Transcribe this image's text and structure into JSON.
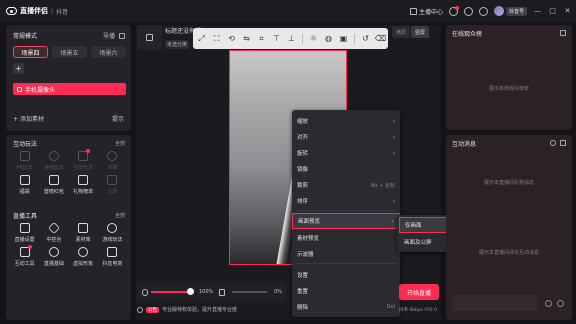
{
  "titlebar": {
    "app_name": "直播伴侣",
    "separator": "|",
    "platform": "抖音",
    "anchor_center": "主播中心",
    "user_name": "抖音号",
    "minimize": "—",
    "maximize": "□",
    "close": "✕"
  },
  "scenes": {
    "title": "常规模式",
    "guide": "导播",
    "tabs": [
      "场景四",
      "场景五",
      "场景六"
    ],
    "add": "+",
    "sources": [
      "手机摄像头"
    ],
    "add_material": "添加素材",
    "hint": "提示"
  },
  "interaction_tools": {
    "title": "互动玩法",
    "more": "全部",
    "items": [
      {
        "label": "PK玩法",
        "enabled": false
      },
      {
        "label": "连线玩法",
        "enabled": false
      },
      {
        "label": "互动玩法",
        "enabled": false
      },
      {
        "label": "点歌",
        "enabled": false
      },
      {
        "label": "福袋",
        "enabled": true
      },
      {
        "label": "登榜红包",
        "enabled": true
      },
      {
        "label": "礼物榜单",
        "enabled": true
      },
      {
        "label": "心愿",
        "enabled": false
      }
    ]
  },
  "live_tools": {
    "title": "直播工具",
    "more": "全部",
    "items": [
      {
        "label": "直播设置"
      },
      {
        "label": "中控台"
      },
      {
        "label": "素材库"
      },
      {
        "label": "游戏玩法"
      },
      {
        "label": "互动工具"
      },
      {
        "label": "直播基础"
      },
      {
        "label": "虚拟形象"
      },
      {
        "label": "抖音电商"
      }
    ]
  },
  "center": {
    "live_title": "标题还没有想好",
    "category": "未选分类",
    "top_tabs": [
      "横屏",
      "竖屏"
    ],
    "toolbar_icons": [
      "fit-icon",
      "fullscreen-icon",
      "rotate-icon",
      "flip-icon",
      "crop-icon",
      "align-top-icon",
      "align-middle-icon",
      "lock-icon",
      "filter-icon",
      "undo-icon",
      "delete-icon"
    ]
  },
  "context_menu": {
    "items": [
      {
        "label": "缩放",
        "arrow": "›",
        "shortcut": ""
      },
      {
        "label": "对齐",
        "arrow": "›",
        "shortcut": ""
      },
      {
        "label": "旋转",
        "arrow": "›",
        "shortcut": ""
      },
      {
        "label": "镜像",
        "arrow": "",
        "shortcut": ""
      },
      {
        "label": "裁剪",
        "arrow": "",
        "shortcut": "Alt + 鼠标"
      },
      {
        "label": "排序",
        "arrow": "›",
        "shortcut": ""
      },
      {
        "label": "画面预览",
        "arrow": "›",
        "shortcut": ""
      },
      {
        "label": "素材预览",
        "arrow": "",
        "shortcut": ""
      },
      {
        "label": "示波器",
        "arrow": "",
        "shortcut": ""
      },
      {
        "label": "设置",
        "arrow": "",
        "shortcut": ""
      },
      {
        "label": "重置",
        "arrow": "",
        "shortcut": ""
      },
      {
        "label": "删除",
        "arrow": "",
        "shortcut": "Del"
      }
    ],
    "submenu": [
      "仅画面",
      "画面及公屏"
    ]
  },
  "bottom": {
    "mic_volume": "100%",
    "speaker_volume": "0%",
    "notice_tag": "公告",
    "notice": "专业版特权体验，提升直播专业度",
    "start_button": "开始直播",
    "stats": "码率 0kbps  FPS 0"
  },
  "right": {
    "audience_title": "在线观众榜",
    "audience_empty": "展示本场观众榜单",
    "messages_title": "互动消息",
    "messages_empty": "展示本直播间礼物消息",
    "messages_empty2": "展示本直播间评论互动消息"
  },
  "colors": {
    "accent": "#fe2c55",
    "bg": "#141418",
    "panel": "#232329"
  }
}
